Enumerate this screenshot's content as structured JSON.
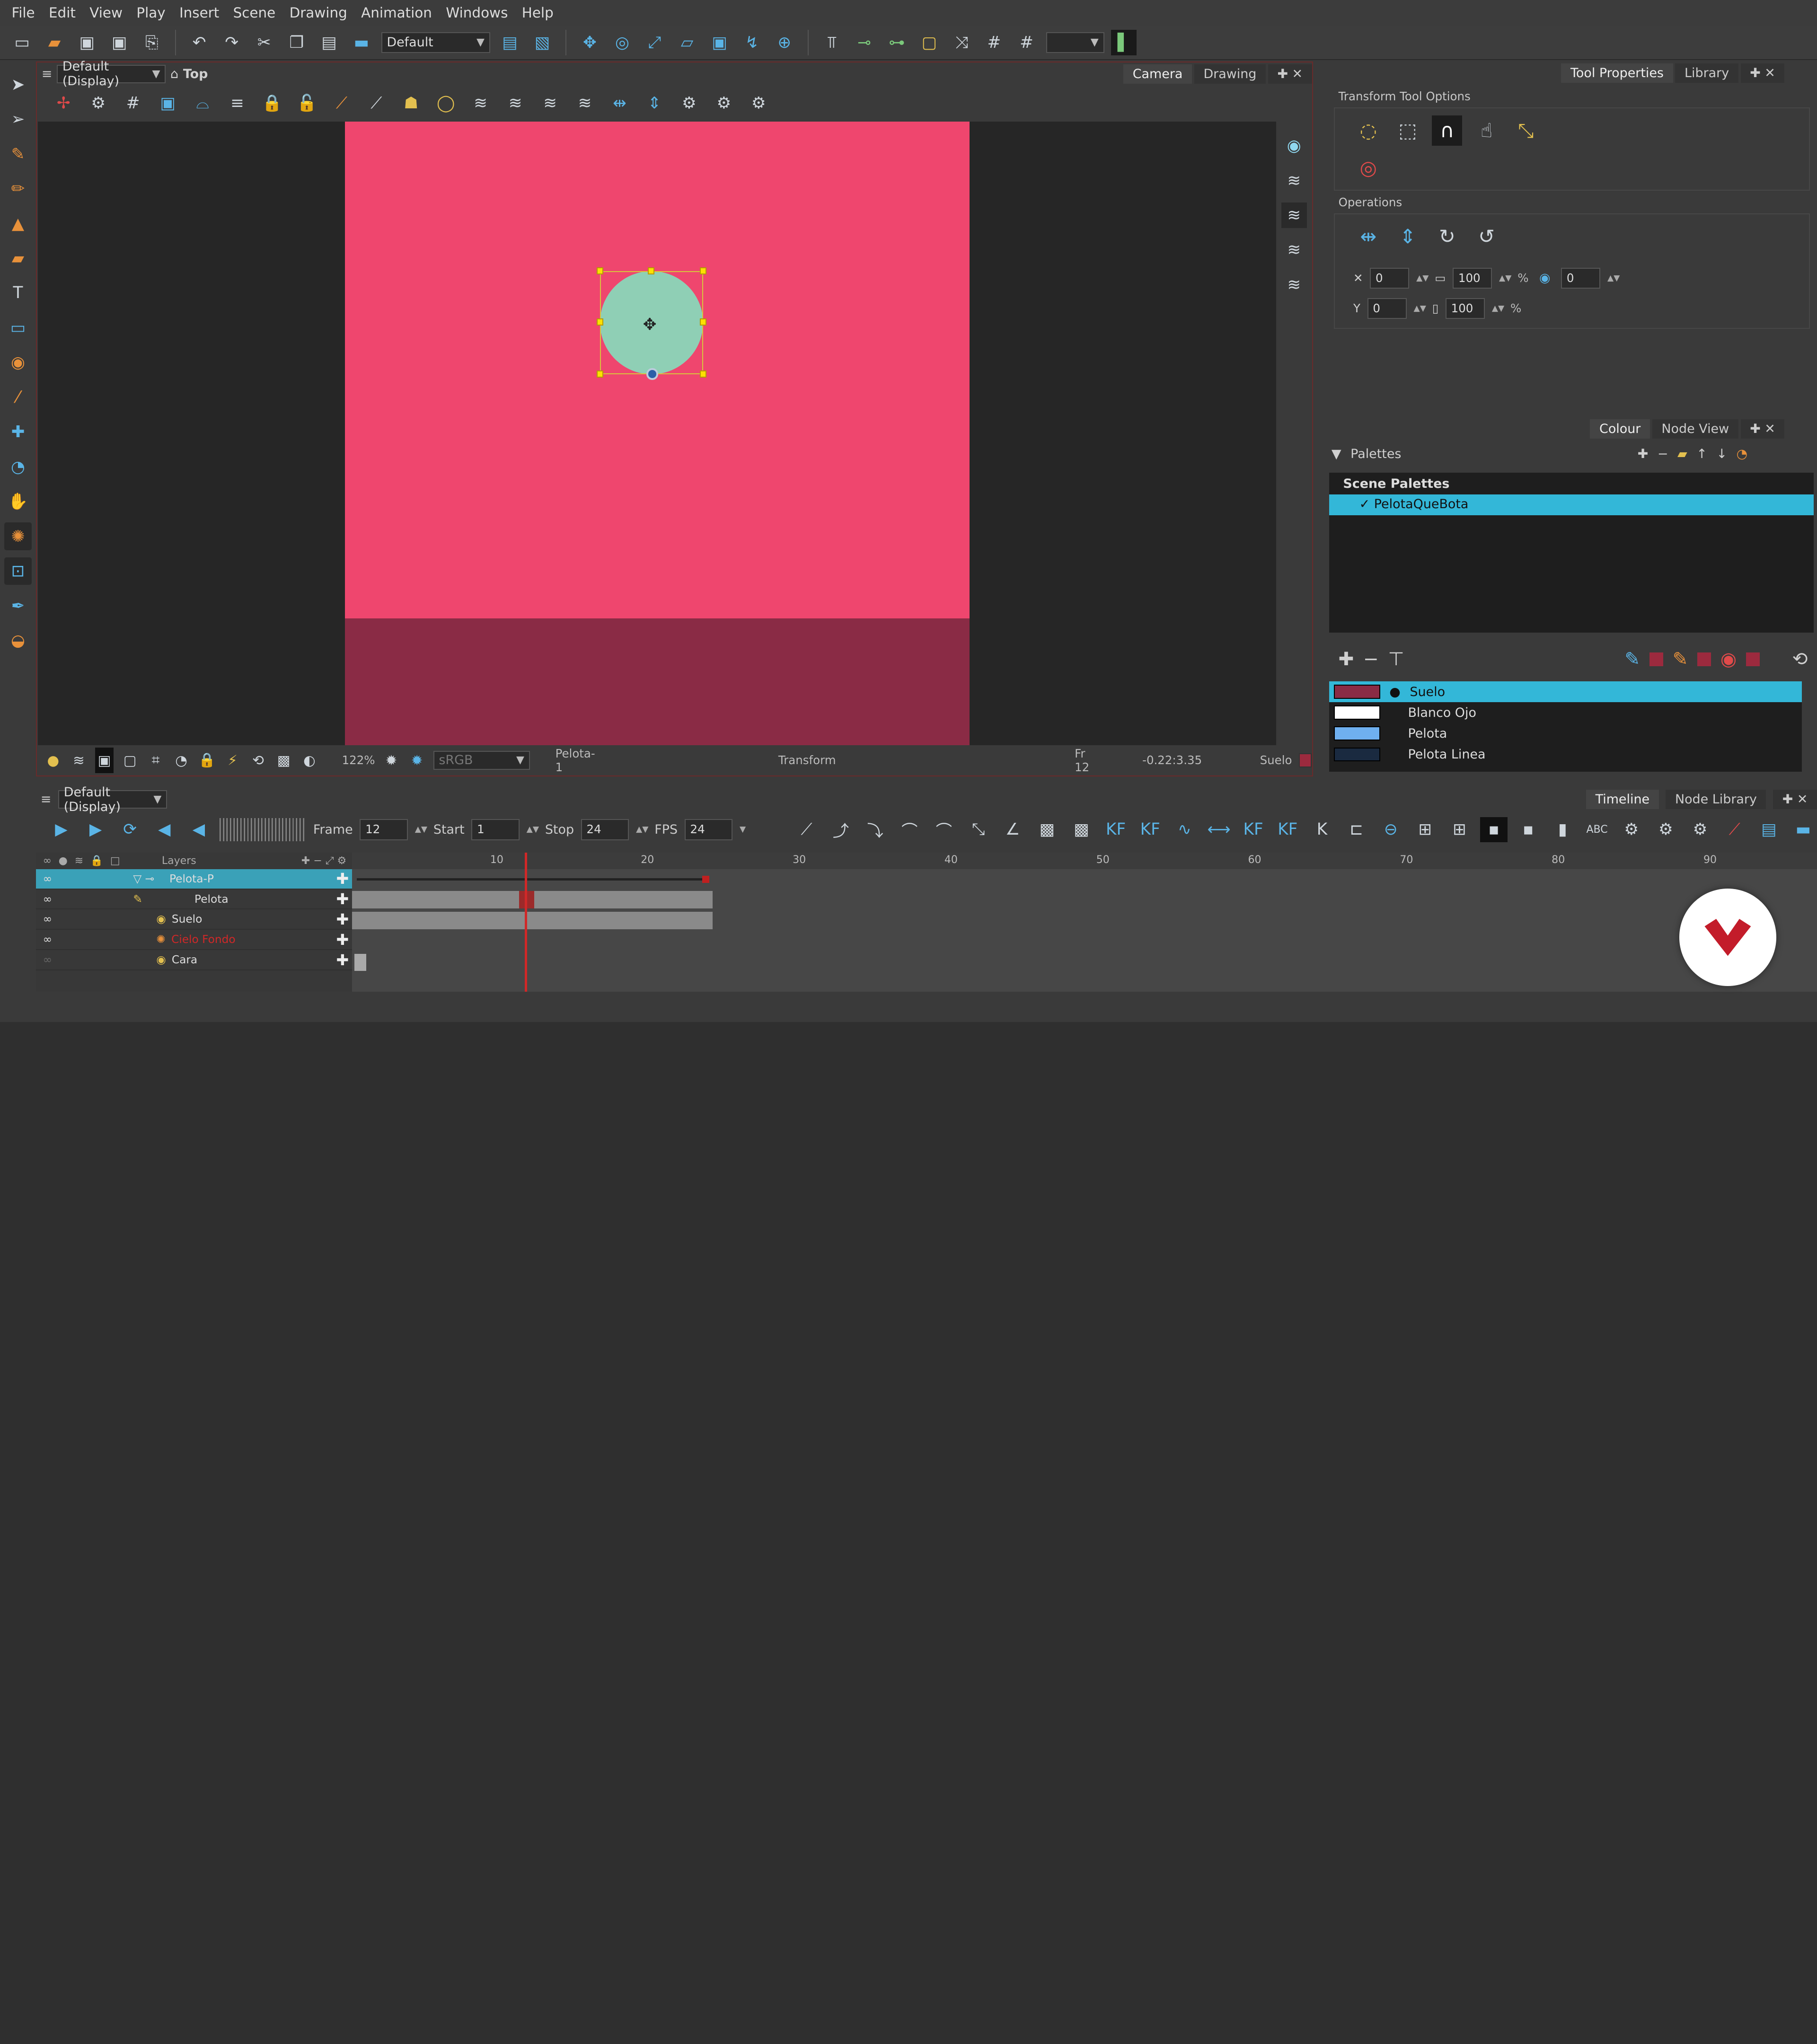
{
  "menu": [
    "File",
    "Edit",
    "View",
    "Play",
    "Insert",
    "Scene",
    "Drawing",
    "Animation",
    "Windows",
    "Help"
  ],
  "toolbar": {
    "workspace": "Default"
  },
  "view": {
    "title": "Default (Display)",
    "subview": "Top",
    "tabs": [
      "Camera",
      "Drawing"
    ],
    "status": {
      "zoom": "122%",
      "colorspace": "sRGB",
      "drawing": "Pelota-1",
      "tool": "Transform",
      "frame": "Fr 12",
      "coords": "-0.22:3.35",
      "colour": "Suelo"
    }
  },
  "colors": {
    "sky": "#ef466e",
    "ground": "#8a2b45",
    "ball": "#8fcfb5",
    "accent": "#33b7d8"
  },
  "tool_properties": {
    "tabs": [
      "Tool Properties",
      "Library"
    ],
    "section": "Transform Tool Options",
    "operations": "Operations",
    "x": "0",
    "y": "0",
    "w": "100",
    "h": "100",
    "angle": "0",
    "pct": "%"
  },
  "colour_panel": {
    "tabs": [
      "Colour",
      "Node View"
    ],
    "palettes_label": "Palettes",
    "scene_palettes": "Scene Palettes",
    "palette": "PelotaQueBota",
    "swatches": [
      {
        "name": "Suelo",
        "color": "#8a2b45"
      },
      {
        "name": "Blanco Ojo",
        "color": "#ffffff"
      },
      {
        "name": "Pelota",
        "color": "#6fb0f0"
      },
      {
        "name": "Pelota Linea",
        "color": "#1a2a40"
      }
    ]
  },
  "timeline": {
    "title": "Default (Display)",
    "tabs": [
      "Timeline",
      "Node Library"
    ],
    "frame_label": "Frame",
    "frame": "12",
    "start_label": "Start",
    "start": "1",
    "stop_label": "Stop",
    "stop": "24",
    "fps_label": "FPS",
    "fps": "24",
    "layers_label": "Layers",
    "kf_label": "KF",
    "abc_label": "ABC",
    "layers": [
      "Pelota-P",
      "Pelota",
      "Suelo",
      "Cielo Fondo",
      "Cara"
    ],
    "ruler": [
      "10",
      "20",
      "30",
      "40",
      "50",
      "60",
      "70",
      "80",
      "90"
    ]
  }
}
